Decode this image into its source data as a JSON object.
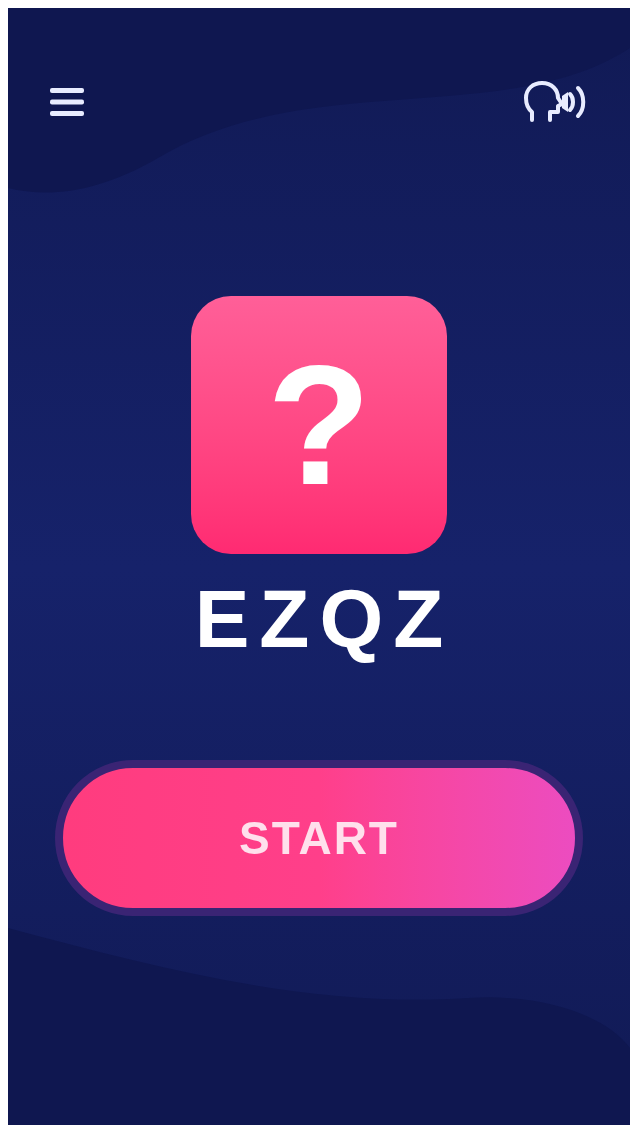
{
  "logo": {
    "glyph": "?",
    "title": "EZQZ"
  },
  "start_button": {
    "label": "START"
  }
}
